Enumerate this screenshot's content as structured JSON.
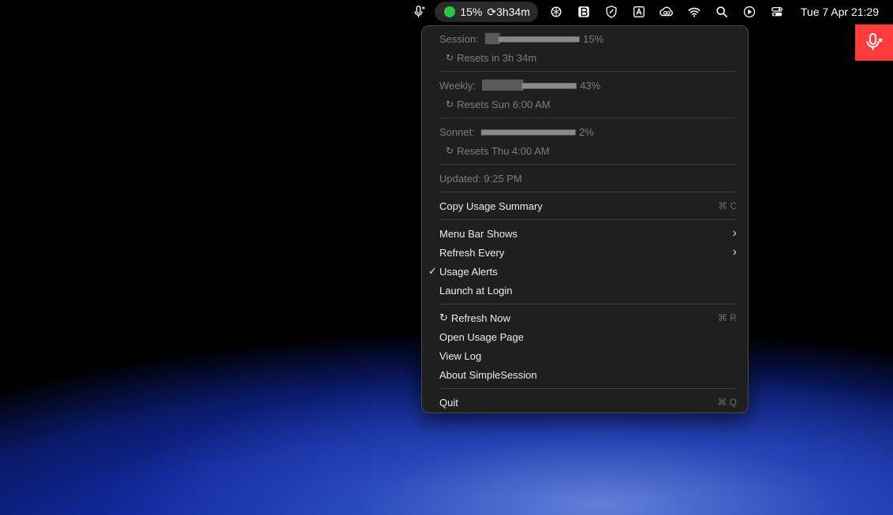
{
  "menubar": {
    "status_percent": "15%",
    "status_timer": "⟳3h34m",
    "clock": "Tue 7 Apr  21:29",
    "icons": [
      "mic-muted-icon",
      "openai-icon",
      "bitwarden-icon",
      "shield-icon",
      "app-icon",
      "creative-cloud-icon",
      "wifi-icon",
      "search-icon",
      "play-icon",
      "control-center-icon"
    ]
  },
  "menu": {
    "session": {
      "label": "Session:",
      "percent": "15%",
      "filled": 3,
      "total": 21,
      "reset": "Resets in 3h 34m"
    },
    "weekly": {
      "label": "Weekly:",
      "percent": "43%",
      "filled": 9,
      "total": 21,
      "reset": "Resets Sun 6:00 AM"
    },
    "sonnet": {
      "label": "Sonnet:",
      "percent": "2%",
      "filled": 0,
      "total": 21,
      "reset": "Resets Thu 4:00 AM"
    },
    "updated": "Updated: 9:25 PM",
    "copy_summary": "Copy Usage Summary",
    "copy_shortcut": "⌘ C",
    "menu_bar_shows": "Menu Bar Shows",
    "refresh_every": "Refresh Every",
    "usage_alerts": "Usage Alerts",
    "launch_at_login": "Launch at Login",
    "refresh_now": "Refresh Now",
    "refresh_shortcut": "⌘ R",
    "open_usage_page": "Open Usage Page",
    "view_log": "View Log",
    "about": "About SimpleSession",
    "quit": "Quit",
    "quit_shortcut": "⌘ Q"
  },
  "colors": {
    "accent_green": "#2ec940",
    "mic_banner": "#ff3b3b"
  }
}
